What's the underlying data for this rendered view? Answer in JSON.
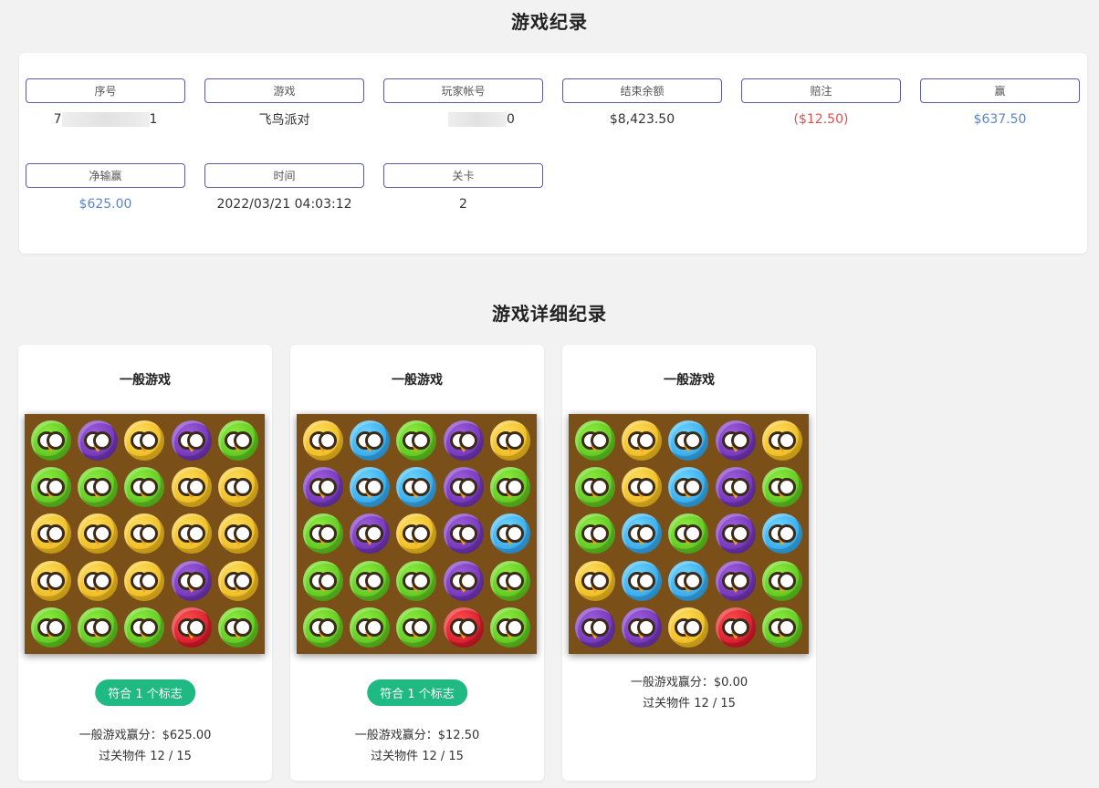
{
  "record_title": "游戏纪录",
  "detail_title": "游戏详细纪录",
  "record_fields": [
    {
      "label": "序号",
      "value_prefix": "7",
      "value_suffix": "1",
      "masked": true,
      "tone": ""
    },
    {
      "label": "游戏",
      "value": "飞鸟派对",
      "tone": ""
    },
    {
      "label": "玩家帐号",
      "value_prefix": "",
      "value_suffix": "0",
      "masked": true,
      "tone": ""
    },
    {
      "label": "结束余额",
      "value": "$8,423.50",
      "tone": ""
    },
    {
      "label": "赔注",
      "value": "($12.50)",
      "tone": "neg"
    },
    {
      "label": "赢",
      "value": "$637.50",
      "tone": "pos"
    },
    {
      "label": "净输赢",
      "value": "$625.00",
      "tone": "pos"
    },
    {
      "label": "时间",
      "value": "2022/03/21 04:03:12",
      "tone": ""
    },
    {
      "label": "关卡",
      "value": "2",
      "tone": ""
    }
  ],
  "detail_cards": [
    {
      "title": "一般游戏",
      "badge": "符合 1 个标志",
      "win_line": "一般游戏赢分：$625.00",
      "items_line": "过关物件 12 / 15",
      "board": [
        [
          "green",
          "purple",
          "yellow",
          "purple",
          "green"
        ],
        [
          "green",
          "green",
          "green",
          "yellow",
          "yellow"
        ],
        [
          "yellow",
          "yellow",
          "yellow",
          "yellow",
          "yellow"
        ],
        [
          "yellow",
          "yellow",
          "yellow",
          "purple",
          "yellow"
        ],
        [
          "green",
          "green",
          "green",
          "red",
          "green"
        ]
      ]
    },
    {
      "title": "一般游戏",
      "badge": "符合 1 个标志",
      "win_line": "一般游戏赢分：$12.50",
      "items_line": "过关物件 12 / 15",
      "board": [
        [
          "yellow",
          "blue",
          "green",
          "purple",
          "yellow"
        ],
        [
          "purple",
          "blue",
          "blue",
          "purple",
          "green"
        ],
        [
          "green",
          "purple",
          "yellow",
          "purple",
          "blue"
        ],
        [
          "green",
          "green",
          "green",
          "purple",
          "green"
        ],
        [
          "green",
          "green",
          "green",
          "red",
          "green"
        ]
      ]
    },
    {
      "title": "一般游戏",
      "badge": "",
      "win_line": "一般游戏赢分：$0.00",
      "items_line": "过关物件 12 / 15",
      "board": [
        [
          "green",
          "yellow",
          "blue",
          "purple",
          "yellow"
        ],
        [
          "green",
          "yellow",
          "blue",
          "purple",
          "green"
        ],
        [
          "green",
          "blue",
          "green",
          "purple",
          "blue"
        ],
        [
          "yellow",
          "blue",
          "blue",
          "purple",
          "green"
        ],
        [
          "purple",
          "purple",
          "yellow",
          "red",
          "green"
        ]
      ]
    }
  ]
}
